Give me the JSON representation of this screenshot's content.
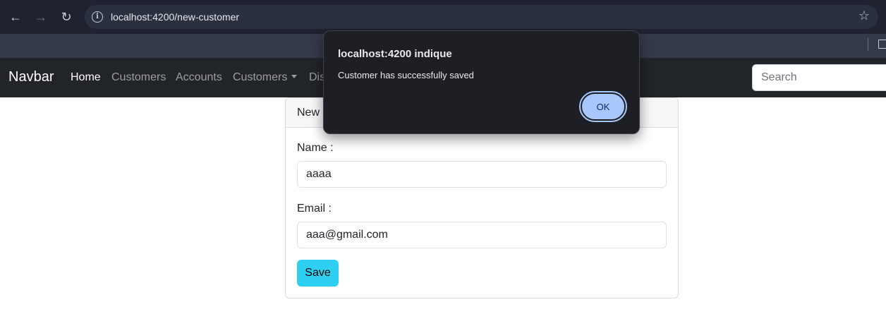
{
  "browser": {
    "url": "localhost:4200/new-customer",
    "icons": {
      "back": "arrow-left-icon",
      "forward": "arrow-right-icon",
      "reload": "reload-icon",
      "site_info": "info-icon",
      "bookmark": "star-icon"
    }
  },
  "navbar": {
    "brand": "Navbar",
    "links": [
      {
        "label": "Home",
        "active": true
      },
      {
        "label": "Customers"
      },
      {
        "label": "Accounts"
      },
      {
        "label": "Customers",
        "dropdown": true
      },
      {
        "label": "Disabled"
      }
    ],
    "search_placeholder": "Search"
  },
  "card": {
    "header": "New Customer",
    "name_label": "Name :",
    "name_value": "aaaa",
    "email_label": "Email :",
    "email_value": "aaa@gmail.com",
    "save_label": "Save"
  },
  "dialog": {
    "title": "localhost:4200 indique",
    "message": "Customer has successfully saved",
    "ok_label": "OK"
  },
  "colors": {
    "navbar_bg": "#212529",
    "save_button": "#2ecff0",
    "dialog_bg": "#1d1f24",
    "ok_button": "#a8c7fa"
  }
}
